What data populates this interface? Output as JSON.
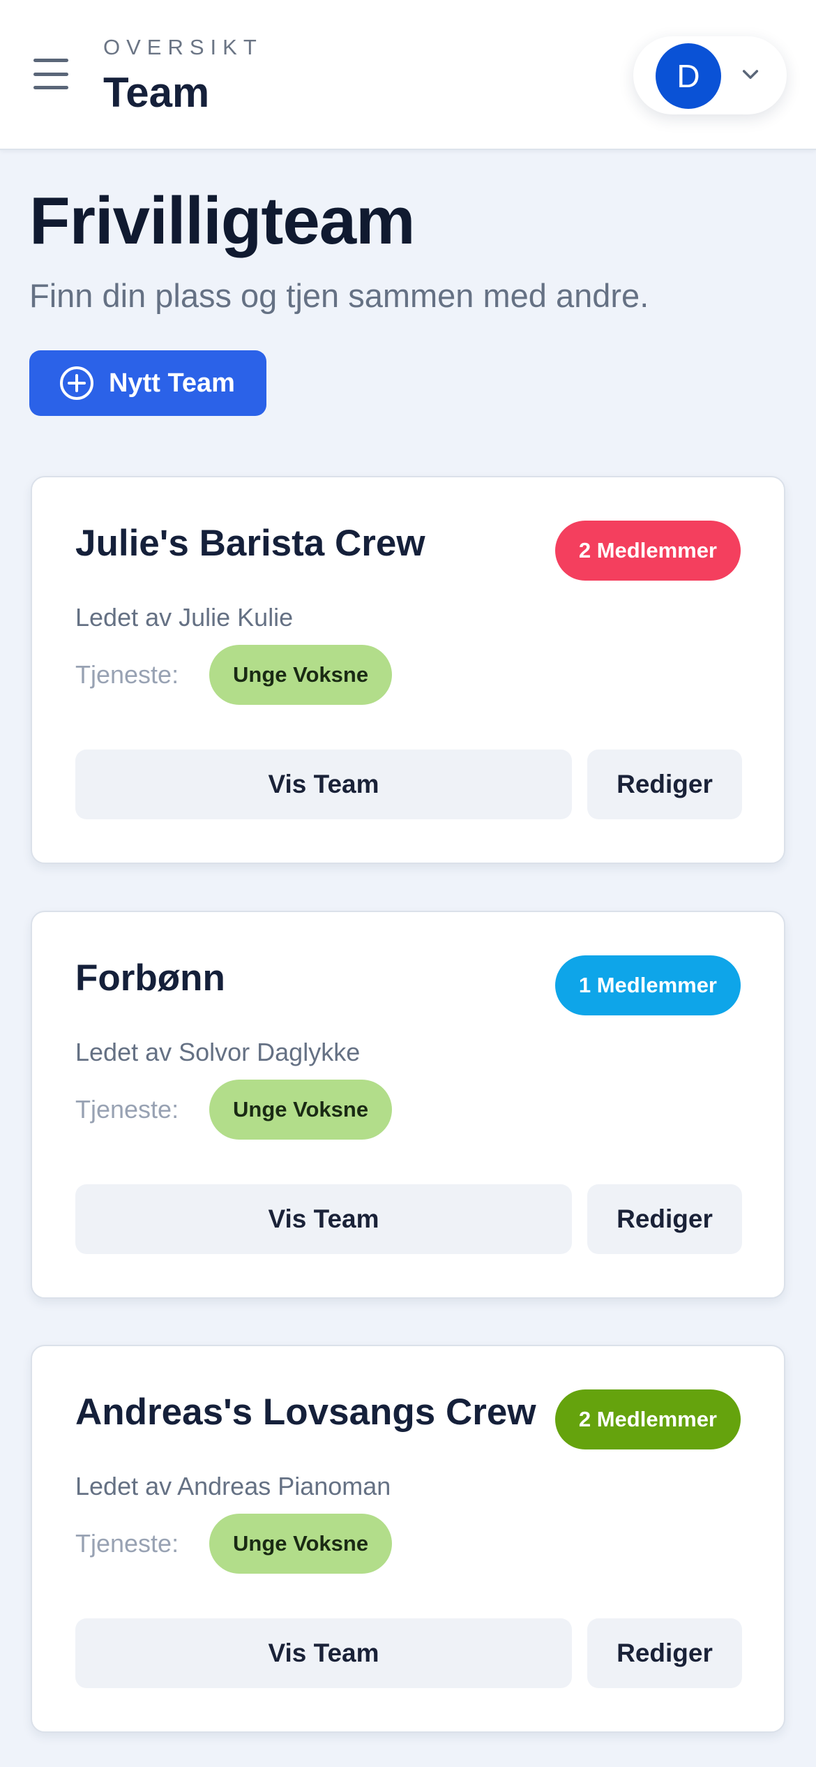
{
  "header": {
    "eyebrow": "OVERSIKT",
    "title": "Team",
    "menu_icon": "hamburger-menu-icon",
    "avatar_initial": "D",
    "avatar_color": "#0a52d6",
    "dropdown_icon": "chevron-down-icon"
  },
  "page": {
    "title": "Frivilligteam",
    "subtitle": "Finn din plass og tjen sammen med andre.",
    "new_team_button": "Nytt Team",
    "new_team_icon": "plus-circle-icon",
    "accent_color": "#2b62e8"
  },
  "teams": [
    {
      "name": "Julie's Barista Crew",
      "members_badge": "2 Medlemmer",
      "badge_color": "#f43f5e",
      "leader": "Ledet av Julie Kulie",
      "service_label": "Tjeneste:",
      "service": "Unge Voksne",
      "view_button": "Vis Team",
      "edit_button": "Rediger"
    },
    {
      "name": "Forbønn",
      "members_badge": "1 Medlemmer",
      "badge_color": "#0ea5e9",
      "leader": "Ledet av Solvor Daglykke",
      "service_label": "Tjeneste:",
      "service": "Unge Voksne",
      "view_button": "Vis Team",
      "edit_button": "Rediger"
    },
    {
      "name": "Andreas's Lovsangs Crew",
      "members_badge": "2 Medlemmer",
      "badge_color": "#65a30d",
      "leader": "Ledet av Andreas Pianoman",
      "service_label": "Tjeneste:",
      "service": "Unge Voksne",
      "view_button": "Vis Team",
      "edit_button": "Rediger"
    }
  ]
}
